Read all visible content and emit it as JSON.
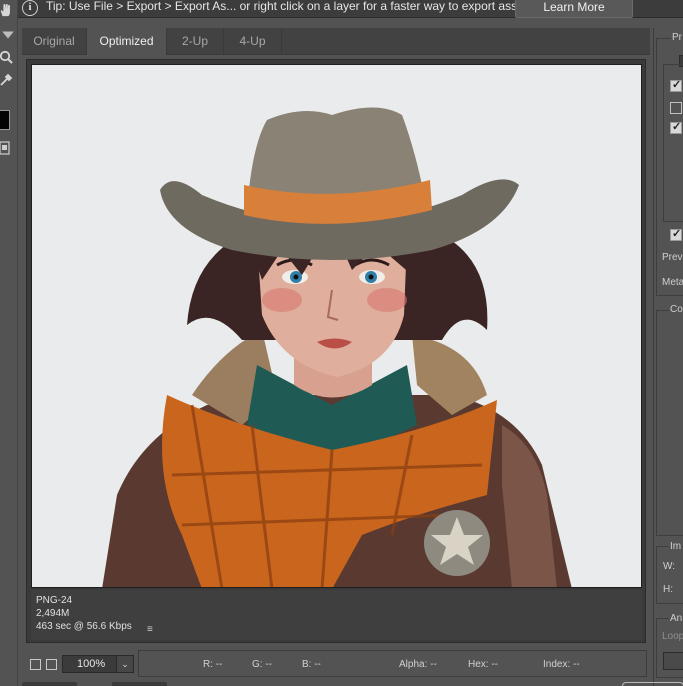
{
  "tipbar": {
    "info_icon": "info-icon",
    "tip_text": "Tip: Use File > Export > Export As...  or right click on a layer for a faster way to export assets",
    "learn_more_label": "Learn More"
  },
  "tabs": [
    {
      "label": "Original",
      "active": false
    },
    {
      "label": "Optimized",
      "active": true
    },
    {
      "label": "2-Up",
      "active": false
    },
    {
      "label": "4-Up",
      "active": false
    }
  ],
  "tools": {
    "icons": [
      "hand-icon",
      "slice-select-icon",
      "zoom-icon",
      "eyedropper-icon",
      "eyedropper-color-swatch",
      "slice-visibility-icon"
    ],
    "swatch_color": "#050505"
  },
  "canvas": {
    "background_color": "#e9ebec",
    "image": "illustration of a cowgirl with brown hat, blue eyes, teal collar, orange plaid scarf and sheriff star badge"
  },
  "info": {
    "format": "PNG-24",
    "size": "2,494M",
    "speed": "463 sec @ 56.6 Kbps",
    "menu_icon": "≡"
  },
  "bottombar": {
    "zoom_value": "100%",
    "zoom_arrow": "⌄",
    "readouts": {
      "r": "R: --",
      "g": "G: --",
      "b": "B: --",
      "alpha": "Alpha: --",
      "hex": "Hex: --",
      "index": "Index: --"
    }
  },
  "right_panel": {
    "preset_label": "Pr",
    "preview_label": "Prev",
    "metadata_label": "Meta",
    "color_table_label": "Co",
    "image_size_label": "Im",
    "width_label": "W:",
    "height_label": "H:",
    "animation_label": "An",
    "looping_label": "Loop"
  }
}
